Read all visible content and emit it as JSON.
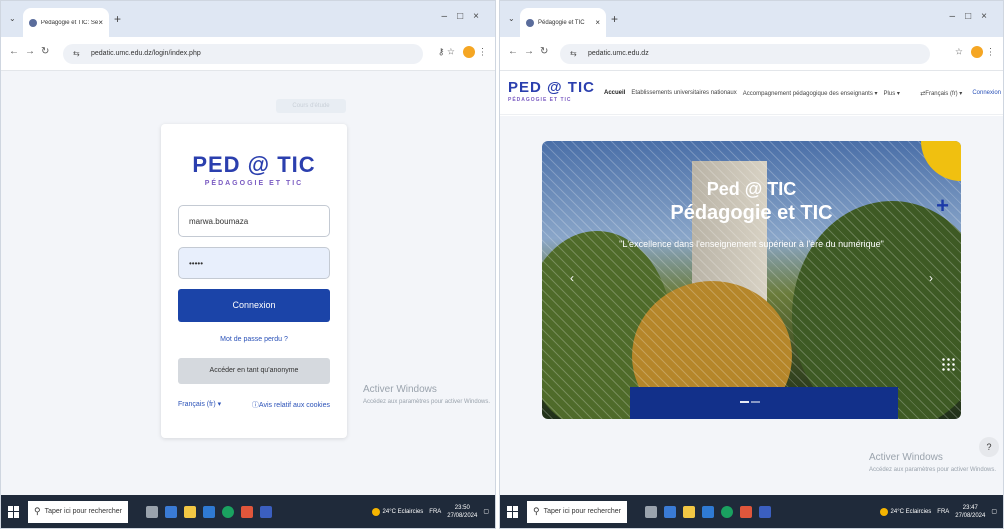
{
  "left": {
    "tab_title": "Pédagogie et TIC: Se connecter",
    "url": "pedatic.umc.edu.dz/login/index.php",
    "ghost_button": "Cours d'étude",
    "brand_big": "PED @ TIC",
    "brand_small": "PÉDAGOGIE ET TIC",
    "username": "marwa.boumaza",
    "password_mask": "•••••",
    "login_button": "Connexion",
    "lost_password": "Mot de passe perdu ?",
    "guest_button": "Accéder en tant qu'anonyme",
    "language": "Français (fr) ▾",
    "cookies": "Avis relatif aux cookies",
    "activate_title": "Activer Windows",
    "activate_sub": "Accédez aux paramètres pour activer Windows.",
    "taskbar": {
      "search": "Taper ici pour rechercher",
      "weather": "24°C Eclaircies",
      "lang": "FRA",
      "time": "23:50",
      "date": "27/08/2024"
    }
  },
  "right": {
    "tab_title": "Pédagogie et TIC",
    "url": "pedatic.umc.edu.dz",
    "brand_big": "PED @ TIC",
    "brand_small": "PÉDAGOGIE ET TIC",
    "menu": [
      "Accueil",
      "Etablissements universitaires nationaux",
      "Accompagnement pédagogique des enseignants ▾",
      "Plus ▾"
    ],
    "language": "Français (fr) ▾",
    "login": "Connexion",
    "hero_title1": "Ped @ TIC",
    "hero_title2": "Pédagogie et TIC",
    "hero_tagline": "\"L'excellence dans l'enseignement supérieur à l'ère du numérique\"",
    "help": "?",
    "activate_title": "Activer Windows",
    "activate_sub": "Accédez aux paramètres pour activer Windows.",
    "taskbar": {
      "search": "Taper ici pour rechercher",
      "weather": "24°C Eclaircies",
      "lang": "FRA",
      "time": "23:47",
      "date": "27/08/2024"
    }
  },
  "colors": {
    "brand_blue": "#2b3fae",
    "brand_purple": "#7b5cc2",
    "button_blue": "#1b44a8",
    "taskbar": "#1f2a3a"
  },
  "icons": [
    "back-icon",
    "forward-icon",
    "reload-icon",
    "site-settings-icon",
    "star-icon",
    "profile-avatar-icon",
    "windows-start-icon",
    "search-icon",
    "sun-icon"
  ]
}
